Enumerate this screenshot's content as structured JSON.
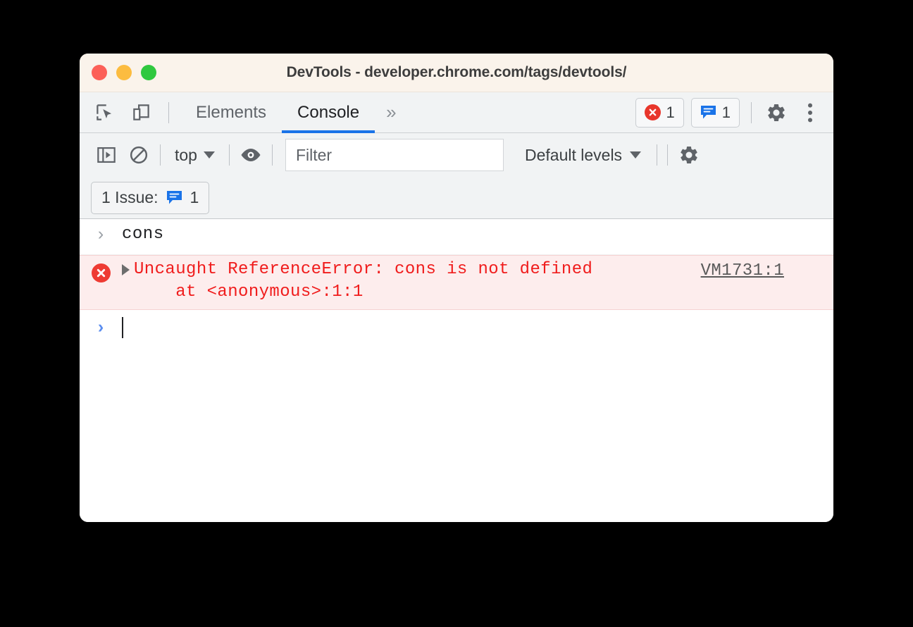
{
  "window": {
    "title": "DevTools - developer.chrome.com/tags/devtools/",
    "traffic_lights": [
      "close",
      "minimize",
      "maximize"
    ]
  },
  "tabbar": {
    "inspect_icon": "inspect-element-icon",
    "device_icon": "device-toolbar-icon",
    "tabs": [
      {
        "label": "Elements",
        "active": false
      },
      {
        "label": "Console",
        "active": true
      }
    ],
    "more_tabs_label": "»",
    "error_count": "1",
    "issue_count": "1",
    "settings_icon": "gear-icon",
    "more_options_icon": "kebab-menu-icon"
  },
  "console_toolbar": {
    "sidebar_icon": "console-sidebar-icon",
    "clear_icon": "clear-console-icon",
    "context_label": "top",
    "eye_icon": "live-expression-icon",
    "filter_placeholder": "Filter",
    "filter_value": "",
    "levels_label": "Default levels",
    "settings_icon": "console-settings-gear-icon"
  },
  "issues_bar": {
    "label": "1 Issue:",
    "icon": "issue-badge-icon",
    "count": "1"
  },
  "console": {
    "entries": [
      {
        "type": "input",
        "prompt": "›",
        "text": "cons"
      },
      {
        "type": "error",
        "icon": "error-circle-icon",
        "disclosure": "expand-triangle-icon",
        "line1": "Uncaught ReferenceError: cons is not defined",
        "line2": "    at <anonymous>:1:1",
        "link": "VM1731:1"
      },
      {
        "type": "prompt",
        "prompt": "›",
        "text": ""
      }
    ]
  },
  "colors": {
    "titlebar_bg": "#faf3eb",
    "toolbar_bg": "#f1f3f4",
    "accent_blue": "#1a73e8",
    "error_red": "#f01c1c",
    "error_row_bg": "#fdeded",
    "issue_blue": "#1a73e8",
    "page_bg": "#000000"
  }
}
